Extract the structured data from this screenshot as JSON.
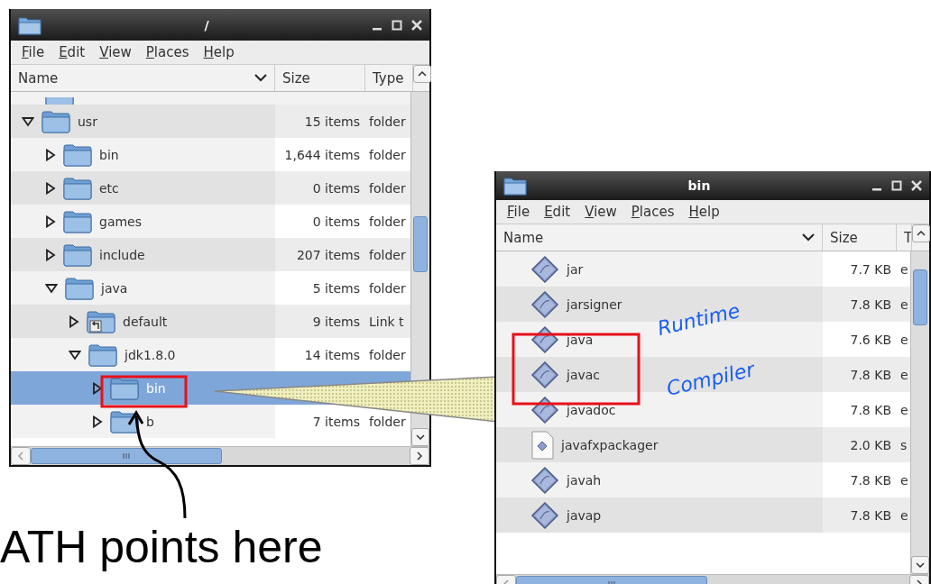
{
  "left_window": {
    "title": "/",
    "menu": [
      "File",
      "Edit",
      "View",
      "Places",
      "Help"
    ],
    "columns": [
      "Name",
      "Size",
      "Type"
    ],
    "tree": [
      {
        "name": "usr",
        "size": "15 items",
        "type": "folder",
        "kind": "folder",
        "expanded": true,
        "selected": false,
        "children": [
          {
            "name": "bin",
            "size": "1,644 items",
            "type": "folder",
            "kind": "folder",
            "expanded": false,
            "selected": false
          },
          {
            "name": "etc",
            "size": "0 items",
            "type": "folder",
            "kind": "folder",
            "expanded": false,
            "selected": false
          },
          {
            "name": "games",
            "size": "0 items",
            "type": "folder",
            "kind": "folder",
            "expanded": false,
            "selected": false
          },
          {
            "name": "include",
            "size": "207 items",
            "type": "folder",
            "kind": "folder",
            "expanded": false,
            "selected": false
          },
          {
            "name": "java",
            "size": "5 items",
            "type": "folder",
            "kind": "folder",
            "expanded": true,
            "selected": false,
            "children": [
              {
                "name": "default",
                "size": "9 items",
                "type": "Link t",
                "kind": "link",
                "expanded": false,
                "selected": false
              },
              {
                "name": "jdk1.8.0",
                "size": "14 items",
                "type": "folder",
                "kind": "folder",
                "expanded": true,
                "selected": false,
                "children": [
                  {
                    "name": "bin",
                    "kind": "folder",
                    "expanded": false,
                    "selected": true
                  },
                  {
                    "name": "b",
                    "size": "7 items",
                    "type": "folder",
                    "kind": "folder",
                    "expanded": false,
                    "selected": false
                  }
                ]
              }
            ]
          }
        ]
      }
    ]
  },
  "right_window": {
    "title": "bin",
    "menu": [
      "File",
      "Edit",
      "View",
      "Places",
      "Help"
    ],
    "columns": [
      "Name",
      "Size",
      "T"
    ],
    "files": [
      {
        "name": "jar",
        "size": "7.7 KB",
        "type": "e",
        "kind": "executable"
      },
      {
        "name": "jarsigner",
        "size": "7.8 KB",
        "type": "e",
        "kind": "executable"
      },
      {
        "name": "java",
        "size": "7.6 KB",
        "type": "e",
        "kind": "executable"
      },
      {
        "name": "javac",
        "size": "7.8 KB",
        "type": "e",
        "kind": "executable"
      },
      {
        "name": "javadoc",
        "size": "7.8 KB",
        "type": "e",
        "kind": "executable"
      },
      {
        "name": "javafxpackager",
        "size": "2.0 KB",
        "type": "s",
        "kind": "script"
      },
      {
        "name": "javah",
        "size": "7.8 KB",
        "type": "e",
        "kind": "executable"
      },
      {
        "name": "javap",
        "size": "7.8 KB",
        "type": "e",
        "kind": "executable"
      }
    ]
  },
  "annotations": {
    "runtime_label": "Runtime",
    "compiler_label": "Compiler",
    "caption": "ATH points here"
  }
}
